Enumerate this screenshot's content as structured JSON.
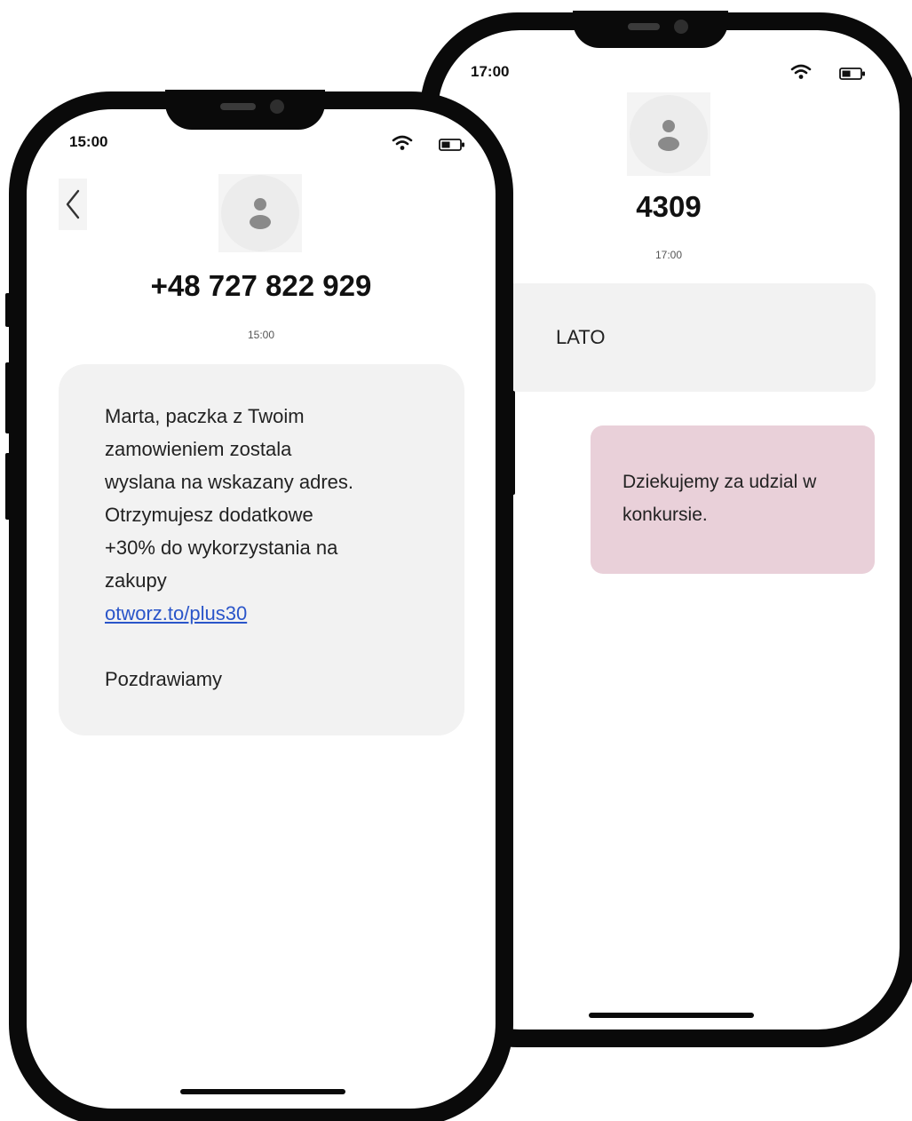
{
  "back_phone": {
    "status": {
      "time": "17:00",
      "wifi_icon": "wifi-icon",
      "battery_icon": "battery-icon"
    },
    "contact": {
      "avatar_icon": "person-icon",
      "name": "4309"
    },
    "thread": {
      "timestamp": "17:00",
      "messages": [
        {
          "direction": "outgoing",
          "text": "LATO"
        },
        {
          "direction": "incoming",
          "text": "Dziekujemy za udzial w konkursie."
        }
      ]
    }
  },
  "front_phone": {
    "status": {
      "time": "15:00",
      "wifi_icon": "wifi-icon",
      "battery_icon": "battery-icon"
    },
    "header": {
      "back_icon": "chevron-left-icon"
    },
    "contact": {
      "avatar_icon": "person-icon",
      "name": "+48 727 822 929"
    },
    "thread": {
      "timestamp": "15:00",
      "message": {
        "lines": [
          "Marta, paczka z Twoim",
          "zamowieniem  zostala",
          "wyslana na wskazany adres.",
          "Otrzymujesz  dodatkowe",
          "+30% do wykorzystania na",
          "zakupy"
        ],
        "link": "otworz.to/plus30",
        "signoff": "Pozdrawiamy"
      }
    }
  },
  "colors": {
    "incoming_bubble": "#f2f2f2",
    "outgoing_bubble": "#e9d0d9",
    "link": "#2a55c9",
    "phone_frame": "#0a0a0a"
  }
}
